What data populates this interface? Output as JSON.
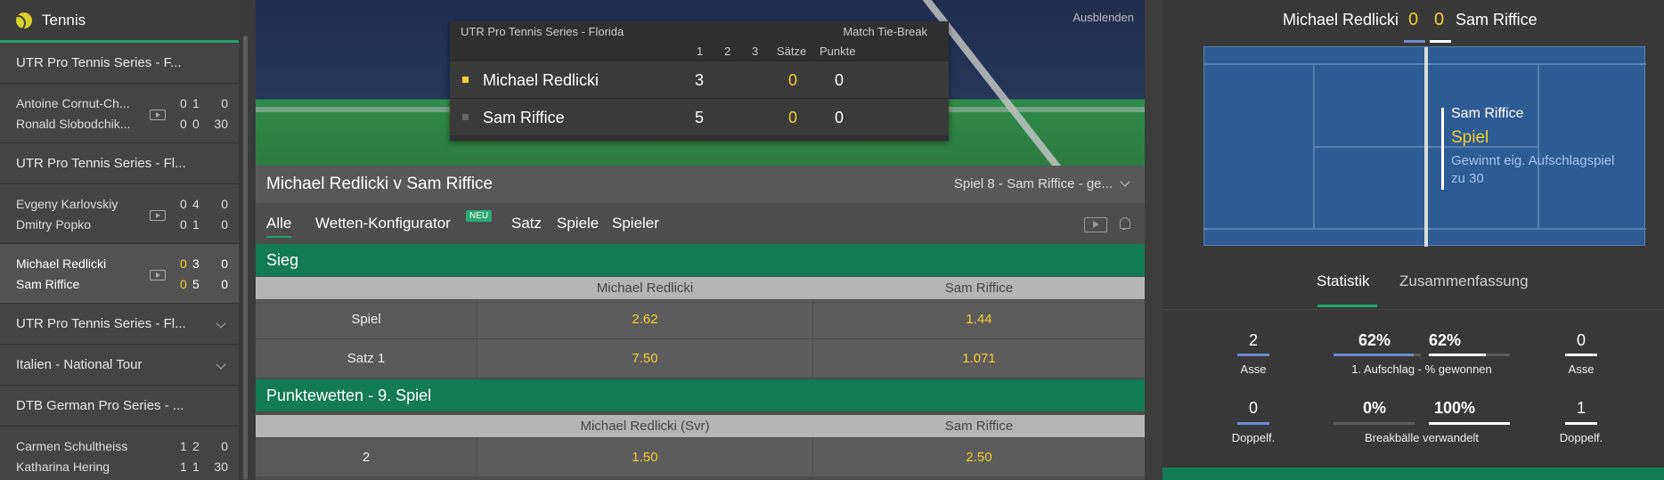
{
  "sidebar": {
    "title": "Tennis",
    "items": [
      {
        "type": "league",
        "label": "UTR Pro Tennis Series - F..."
      },
      {
        "type": "match",
        "p1": "Antoine Cornut-Ch...",
        "p2": "Ronald Slobodchik...",
        "s1": [
          "0",
          "1",
          "0"
        ],
        "s2": [
          "0",
          "0",
          "30"
        ],
        "active": false
      },
      {
        "type": "league",
        "label": "UTR Pro Tennis Series - Fl..."
      },
      {
        "type": "match",
        "p1": "Evgeny Karlovskiy",
        "p2": "Dmitry Popko",
        "s1": [
          "0",
          "4",
          "0"
        ],
        "s2": [
          "0",
          "1",
          "0"
        ],
        "active": false
      },
      {
        "type": "match",
        "p1": "Michael Redlicki",
        "p2": "Sam Riffice",
        "s1": [
          "0",
          "3",
          "0"
        ],
        "s2": [
          "0",
          "5",
          "0"
        ],
        "active": true
      },
      {
        "type": "league",
        "label": "UTR Pro Tennis Series - Fl...",
        "chevron": true
      },
      {
        "type": "league",
        "label": "Italien - National Tour",
        "chevron": true
      },
      {
        "type": "league",
        "label": "DTB German Pro Series - ..."
      },
      {
        "type": "match",
        "p1": "Carmen Schultheiss",
        "p2": "Katharina Hering",
        "s1": [
          "1",
          "2",
          "0"
        ],
        "s2": [
          "1",
          "1",
          "30"
        ],
        "active": false
      }
    ]
  },
  "scoreboard": {
    "hide": "Ausblenden",
    "tournament": "UTR Pro Tennis Series - Florida",
    "mode": "Match Tie-Break",
    "headers": [
      "1",
      "2",
      "3",
      "Sätze",
      "Punkte"
    ],
    "p1": {
      "name": "Michael Redlicki",
      "set1": "3",
      "sets": "0",
      "points": "0"
    },
    "p2": {
      "name": "Sam Riffice",
      "set1": "5",
      "sets": "0",
      "points": "0"
    }
  },
  "match": {
    "title": "Michael Redlicki v Sam Riffice",
    "game": "Spiel 8 - Sam Riffice - ge..."
  },
  "tabs": [
    {
      "label": "Alle",
      "active": true
    },
    {
      "label": "Wetten-Konfigurator",
      "badge": "NEU"
    },
    {
      "label": "Satz"
    },
    {
      "label": "Spiele"
    },
    {
      "label": "Spieler"
    }
  ],
  "markets": {
    "sieg": {
      "title": "Sieg",
      "col1": "Michael Redlicki",
      "col2": "Sam Riffice",
      "rows": [
        {
          "label": "Spiel",
          "o1": "2.62",
          "o2": "1.44"
        },
        {
          "label": "Satz 1",
          "o1": "7.50",
          "o2": "1.071"
        }
      ]
    },
    "punkte": {
      "title": "Punktewetten - 9. Spiel",
      "col1": "Michael Redlicki (Svr)",
      "col2": "Sam Riffice",
      "rows": [
        {
          "label": "2",
          "o1": "1.50",
          "o2": "2.50"
        }
      ]
    }
  },
  "right": {
    "p1": "Michael Redlicki",
    "p1_score": "0",
    "p2_score": "0",
    "p2": "Sam Riffice",
    "event": {
      "player": "Sam Riffice",
      "action": "Spiel",
      "desc": "Gewinnt eig. Aufschlagspiel zu 30"
    },
    "tabs": {
      "stats": "Statistik",
      "summary": "Zusammenfassung"
    },
    "stats": {
      "aces_p1": "2",
      "aces_label": "Asse",
      "aces_p2": "0",
      "first_serve_p1": "62%",
      "first_serve_p2": "62%",
      "first_serve_label": "1. Aufschlag - % gewonnen",
      "df_p1": "0",
      "df_label": "Doppelf.",
      "df_p2": "1",
      "bp_p1": "0%",
      "bp_p2": "100%",
      "bp_label": "Breakbälle verwandelt"
    }
  },
  "colors": {
    "accent": "#1fa36b",
    "market_green": "#127a55",
    "odds": "#f3d02f",
    "court": "#2e5b94"
  }
}
